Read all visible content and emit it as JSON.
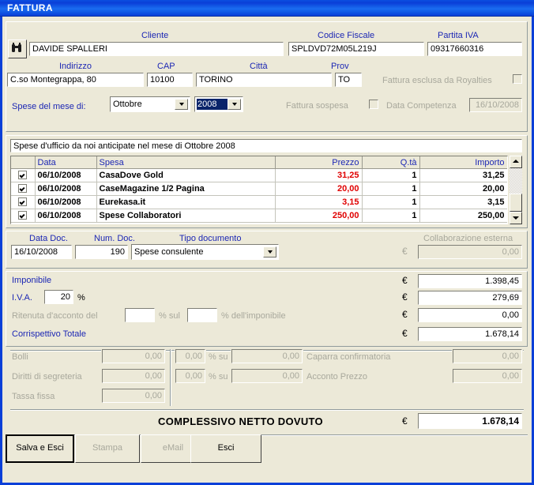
{
  "window": {
    "title": "FATTURA"
  },
  "header": {
    "search_icon": "binoculars-icon",
    "cliente_label": "Cliente",
    "cliente_value": "DAVIDE SPALLERI",
    "codice_fiscale_label": "Codice Fiscale",
    "codice_fiscale_value": "SPLDVD72M05L219J",
    "partita_iva_label": "Partita IVA",
    "partita_iva_value": "09317660316",
    "indirizzo_label": "Indirizzo",
    "indirizzo_value": "C.so Montegrappa, 80",
    "cap_label": "CAP",
    "cap_value": "10100",
    "citta_label": "Città",
    "citta_value": "TORINO",
    "prov_label": "Prov",
    "prov_value": "TO",
    "royalties_label": "Fattura esclusa da Royalties",
    "royalties_checked": false,
    "spese_mese_label": "Spese del mese di:",
    "mese_value": "Ottobre",
    "anno_value": "2008",
    "sospesa_label": "Fattura sospesa",
    "sospesa_checked": false,
    "data_competenza_label": "Data Competenza",
    "data_competenza_value": "16/10/2008"
  },
  "description": {
    "value": "Spese d'ufficio da noi anticipate nel mese di Ottobre 2008"
  },
  "grid": {
    "columns": [
      "",
      "Data",
      "Spesa",
      "Prezzo",
      "Q.tà",
      "Importo"
    ],
    "rows": [
      {
        "checked": true,
        "data": "06/10/2008",
        "spesa": "CasaDove Gold",
        "prezzo": "31,25",
        "qta": "1",
        "importo": "31,25"
      },
      {
        "checked": true,
        "data": "06/10/2008",
        "spesa": "CaseMagazine 1/2 Pagina",
        "prezzo": "20,00",
        "qta": "1",
        "importo": "20,00"
      },
      {
        "checked": true,
        "data": "06/10/2008",
        "spesa": "Eurekasa.it",
        "prezzo": "3,15",
        "qta": "1",
        "importo": "3,15"
      },
      {
        "checked": true,
        "data": "06/10/2008",
        "spesa": "Spese Collaboratori",
        "prezzo": "250,00",
        "qta": "1",
        "importo": "250,00"
      }
    ]
  },
  "document": {
    "data_doc_label": "Data Doc.",
    "data_doc_value": "16/10/2008",
    "num_doc_label": "Num. Doc.",
    "num_doc_value": "190",
    "tipo_doc_label": "Tipo documento",
    "tipo_doc_value": "Spese consulente",
    "collaborazione_label": "Collaborazione esterna",
    "collaborazione_value": "0,00",
    "euro_symbol": "€"
  },
  "totals": {
    "imponibile_label": "Imponibile",
    "imponibile_value": "1.398,45",
    "iva_label": "I.V.A.",
    "iva_rate": "20",
    "iva_percent_sign": "%",
    "iva_value": "279,69",
    "ritenuta_label": "Ritenuta d'acconto del",
    "ritenuta_rate": "",
    "ritenuta_sul_label": "% sul",
    "ritenuta_sul_rate": "",
    "ritenuta_imponibile_label": "% dell'imponibile",
    "ritenuta_value": "0,00",
    "corrispettivo_label": "Corrispettivo Totale",
    "corrispettivo_value": "1.678,14",
    "euro_symbol": "€"
  },
  "extras": {
    "bolli_label": "Bolli",
    "bolli_value": "0,00",
    "diritti_label": "Diritti di segreteria",
    "diritti_value": "0,00",
    "tassa_label": "Tassa fissa",
    "tassa_value": "0,00",
    "caparra_pct": "0,00",
    "caparra_su_label": "% su",
    "caparra_base": "0,00",
    "caparra_label": "Caparra confirmatoria",
    "caparra_value": "0,00",
    "acconto_pct": "0,00",
    "acconto_su_label": "% su",
    "acconto_base": "0,00",
    "acconto_label": "Acconto Prezzo",
    "acconto_value": "0,00"
  },
  "grand_total": {
    "label": "COMPLESSIVO NETTO DOVUTO",
    "euro_symbol": "€",
    "value": "1.678,14"
  },
  "buttons": {
    "salva": "Salva e Esci",
    "stampa": "Stampa",
    "email": "eMail",
    "esci": "Esci"
  },
  "colors": {
    "title_bar": "#0a3fd8",
    "label_blue": "#1c27b4",
    "price_red": "#e00000",
    "face": "#ece9d8",
    "disabled_text": "#a8a89c"
  }
}
